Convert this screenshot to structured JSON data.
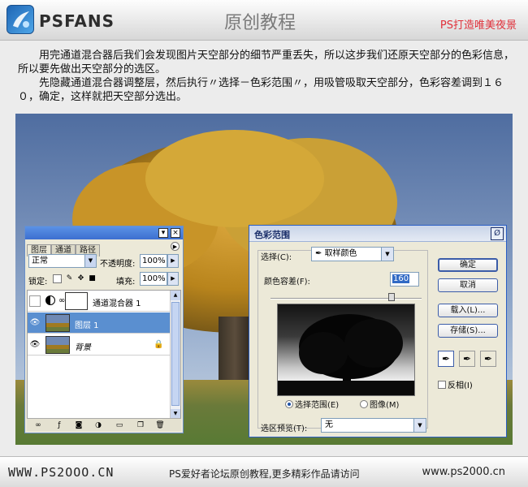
{
  "header": {
    "logo_text": "PSFANS",
    "title": "原创教程",
    "tagline": "PS打造唯美夜景"
  },
  "intro": {
    "para1": "用完通道混合器后我们会发现图片天空部分的细节严重丢失，所以这步我们还原天空部分的色彩信息，所以要先做出天空部分的选区。",
    "para2": "先隐藏通道混合器调整层，然后执行〃选择－色彩范围〃，用吸管吸取天空部分，色彩容差调到１６０，确定，这样就把天空部分选出。"
  },
  "layers_panel": {
    "tabs": [
      "图层",
      "通道",
      "路径"
    ],
    "blend_mode": "正常",
    "opacity_label": "不透明度:",
    "opacity_value": "100%",
    "lock_label": "锁定:",
    "fill_label": "填充:",
    "fill_value": "100%",
    "layers": [
      {
        "name": "通道混合器 1",
        "visible": false,
        "selected": false
      },
      {
        "name": "图层 1",
        "visible": true,
        "selected": true
      },
      {
        "name": "背景",
        "visible": true,
        "selected": false
      }
    ]
  },
  "color_range": {
    "title": "色彩范围",
    "select_label": "选择(C):",
    "select_value": "取样颜色",
    "fuzziness_label": "颜色容差(F):",
    "fuzziness_value": "160",
    "fuzziness_fraction": 0.8,
    "radio_selection": "选择范围(E)",
    "radio_image": "图像(M)",
    "preview_label": "选区预览(T):",
    "preview_value": "无",
    "buttons": {
      "ok": "确定",
      "cancel": "取消",
      "load": "载入(L)...",
      "save": "存储(S)..."
    },
    "invert_label": "反相(I)"
  },
  "footer": {
    "left": "WWW.PS2OOO.CN",
    "middle": "PS爱好者论坛原创教程,更多精彩作品请访问",
    "right": "www.ps2000.cn"
  }
}
